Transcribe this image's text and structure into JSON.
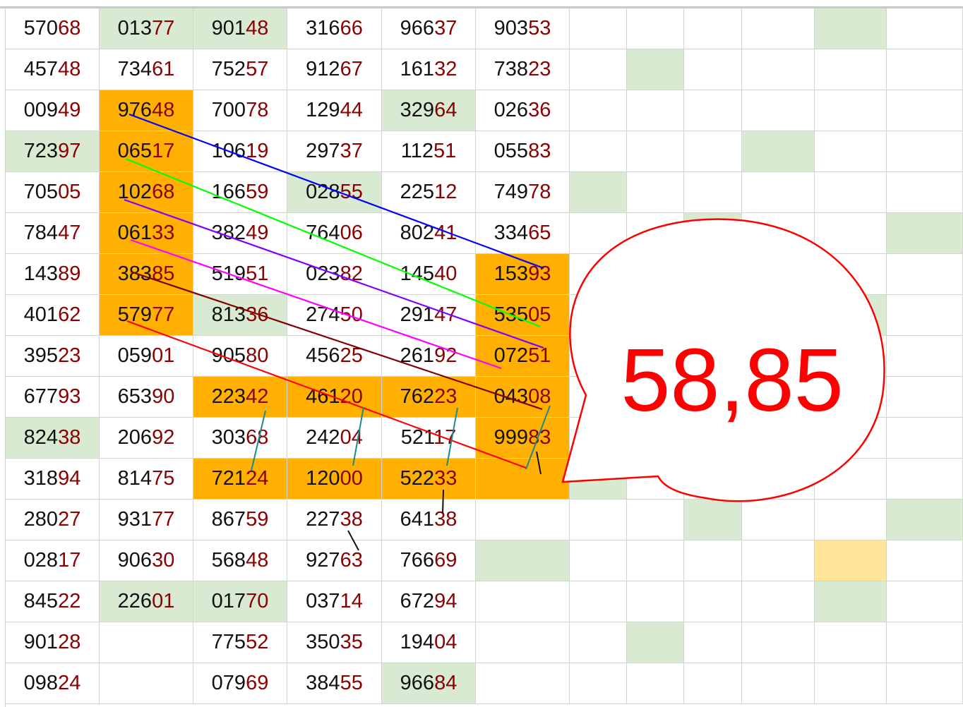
{
  "grid": {
    "rows": [
      [
        "57068",
        "01377",
        "90148",
        "31666",
        "96637",
        "90353",
        "",
        "",
        "",
        "",
        "",
        ""
      ],
      [
        "45748",
        "73461",
        "75257",
        "91267",
        "16132",
        "73823",
        "",
        "",
        "",
        "",
        "",
        ""
      ],
      [
        "00949",
        "97648",
        "70078",
        "12944",
        "32964",
        "02636",
        "",
        "",
        "",
        "",
        "",
        ""
      ],
      [
        "72397",
        "06517",
        "10619",
        "29737",
        "11251",
        "05583",
        "",
        "",
        "",
        "",
        "",
        ""
      ],
      [
        "70505",
        "10268",
        "16659",
        "02855",
        "22512",
        "74978",
        "",
        "",
        "",
        "",
        "",
        ""
      ],
      [
        "78447",
        "06133",
        "38249",
        "76406",
        "80241",
        "33465",
        "",
        "",
        "",
        "",
        "",
        ""
      ],
      [
        "14389",
        "38385",
        "51951",
        "02382",
        "14540",
        "15393",
        "",
        "",
        "",
        "",
        "",
        ""
      ],
      [
        "40162",
        "57977",
        "81336",
        "27450",
        "29147",
        "53505",
        "",
        "",
        "",
        "",
        "",
        ""
      ],
      [
        "39523",
        "05901",
        "90580",
        "45625",
        "26192",
        "07251",
        "",
        "",
        "",
        "",
        "",
        ""
      ],
      [
        "67793",
        "65390",
        "22342",
        "46120",
        "76223",
        "04308",
        "",
        "",
        "",
        "",
        "",
        ""
      ],
      [
        "82438",
        "20692",
        "30368",
        "24204",
        "52117",
        "99983",
        "",
        "",
        "",
        "",
        "",
        ""
      ],
      [
        "31894",
        "81475",
        "72124",
        "12000",
        "52233",
        "",
        "",
        "",
        "",
        "",
        "",
        ""
      ],
      [
        "28027",
        "93177",
        "86759",
        "22738",
        "64138",
        "",
        "",
        "",
        "",
        "",
        "",
        ""
      ],
      [
        "02817",
        "90630",
        "56848",
        "92763",
        "76669",
        "",
        "",
        "",
        "",
        "",
        "",
        ""
      ],
      [
        "84522",
        "22601",
        "01770",
        "03714",
        "67294",
        "",
        "",
        "",
        "",
        "",
        "",
        ""
      ],
      [
        "90128",
        "",
        "77552",
        "35035",
        "19404",
        "",
        "",
        "",
        "",
        "",
        "",
        ""
      ],
      [
        "09824",
        "",
        "07969",
        "38455",
        "96684",
        "",
        "",
        "",
        "",
        "",
        "",
        ""
      ]
    ],
    "fills": [
      [
        null,
        "green",
        "green",
        null,
        null,
        null,
        null,
        null,
        null,
        null,
        "green",
        null
      ],
      [
        null,
        null,
        null,
        null,
        null,
        null,
        null,
        "green",
        null,
        null,
        null,
        null
      ],
      [
        null,
        "orange",
        null,
        null,
        "green",
        null,
        null,
        null,
        null,
        null,
        null,
        null
      ],
      [
        "green",
        "orange",
        null,
        null,
        null,
        null,
        null,
        null,
        null,
        "green",
        null,
        null
      ],
      [
        null,
        "orange",
        null,
        "green",
        null,
        null,
        "green",
        null,
        null,
        null,
        null,
        null
      ],
      [
        null,
        "orange",
        null,
        null,
        null,
        null,
        null,
        null,
        "green",
        null,
        null,
        "green"
      ],
      [
        null,
        "orange",
        null,
        null,
        null,
        "orange",
        null,
        null,
        null,
        null,
        null,
        null
      ],
      [
        null,
        "orange",
        "green",
        null,
        null,
        "orange",
        null,
        null,
        null,
        null,
        "green",
        null
      ],
      [
        null,
        null,
        null,
        null,
        null,
        "orange",
        null,
        null,
        null,
        null,
        null,
        null
      ],
      [
        null,
        null,
        "orange",
        "orange",
        "orange",
        "orange",
        null,
        null,
        null,
        null,
        null,
        null
      ],
      [
        "green",
        null,
        null,
        null,
        null,
        "orange",
        null,
        null,
        null,
        "green",
        null,
        null
      ],
      [
        null,
        null,
        "orange",
        "orange",
        "orange",
        "orange",
        "green",
        null,
        null,
        null,
        null,
        null
      ],
      [
        null,
        null,
        null,
        null,
        null,
        null,
        null,
        null,
        "green",
        null,
        null,
        "green"
      ],
      [
        null,
        null,
        null,
        null,
        null,
        "green",
        null,
        null,
        null,
        null,
        "yellow",
        null
      ],
      [
        null,
        "green",
        "green",
        null,
        null,
        null,
        null,
        null,
        null,
        null,
        "green",
        null
      ],
      [
        null,
        null,
        null,
        null,
        null,
        null,
        null,
        "green",
        null,
        null,
        null,
        null
      ],
      [
        null,
        null,
        null,
        null,
        "green",
        null,
        null,
        null,
        null,
        null,
        null,
        null
      ]
    ]
  },
  "callout": {
    "text": "58,85"
  },
  "colors": {
    "digit_black": "#111111",
    "digit_red": "#8b0000",
    "green": "#d9ead3",
    "orange": "#ffb000",
    "yellow": "#ffe599",
    "callout_red": "#ff0000"
  },
  "annotations": {
    "diagonal_colors": [
      "#0000ff",
      "#00ff00",
      "#8000ff",
      "#ff00ff",
      "#800000",
      "#ff0000"
    ],
    "tick_color": "#1a8a8a"
  }
}
